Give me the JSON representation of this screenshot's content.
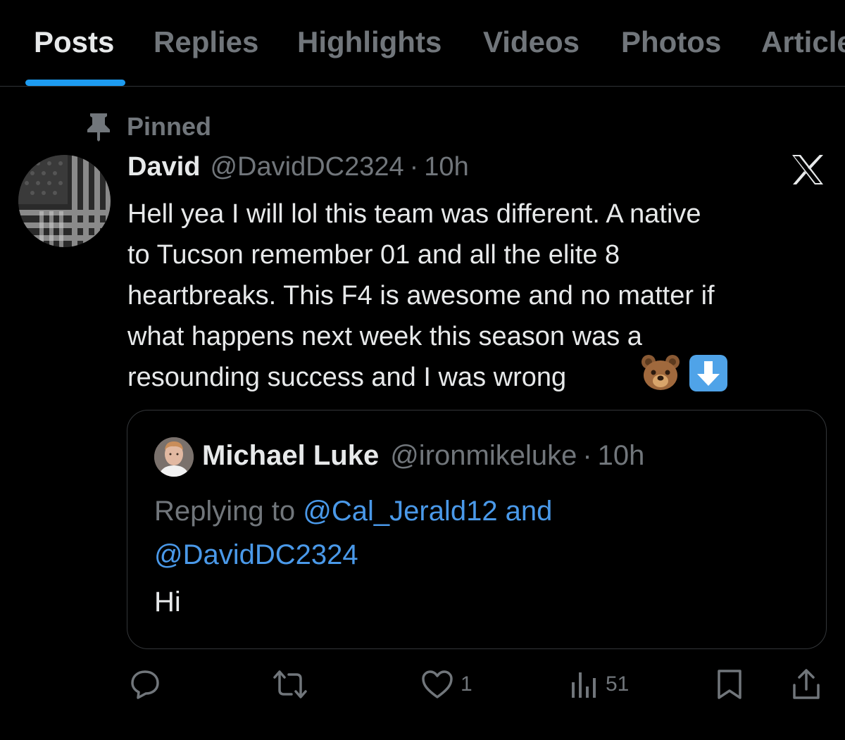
{
  "tabs": [
    {
      "label": "Posts",
      "active": true
    },
    {
      "label": "Replies",
      "active": false
    },
    {
      "label": "Highlights",
      "active": false
    },
    {
      "label": "Videos",
      "active": false
    },
    {
      "label": "Photos",
      "active": false
    },
    {
      "label": "Articles",
      "active": false
    }
  ],
  "pinned": {
    "label": "Pinned",
    "icon": "pin-icon"
  },
  "tweet": {
    "author_name": "David",
    "author_handle": "@DavidDC2324",
    "separator": "·",
    "time": "10h",
    "text": "Hell yea I will lol this team was different. A native\nto Tucson remember 01 and all the elite 8\nheartbreaks. This F4 is awesome and no matter if\nwhat happens next week this season was a\nresounding success and I was wrong",
    "emojis": [
      "bear-face-emoji",
      "down-arrow-emoji"
    ],
    "platform_icon": "x-logo-icon"
  },
  "quote": {
    "author_name": "Michael Luke",
    "author_handle": "@ironmikeluke",
    "separator": "·",
    "time": "10h",
    "replying_prefix": "Replying to",
    "replying_mention_1": "@Cal_Jerald12 and",
    "replying_mention_2": "@DavidDC2324",
    "text": "Hi"
  },
  "actions": {
    "reply": {
      "icon": "reply-icon",
      "count": ""
    },
    "repost": {
      "icon": "repost-icon",
      "count": ""
    },
    "like": {
      "icon": "heart-icon",
      "count": "1"
    },
    "views": {
      "icon": "analytics-icon",
      "count": "51"
    },
    "bookmark": {
      "icon": "bookmark-icon"
    },
    "share": {
      "icon": "share-icon"
    }
  },
  "colors": {
    "background": "#000000",
    "text_primary": "#e7e9ea",
    "text_secondary": "#71767b",
    "accent": "#1d9bf0",
    "mention": "#4a99e9",
    "border": "#2f3336"
  }
}
